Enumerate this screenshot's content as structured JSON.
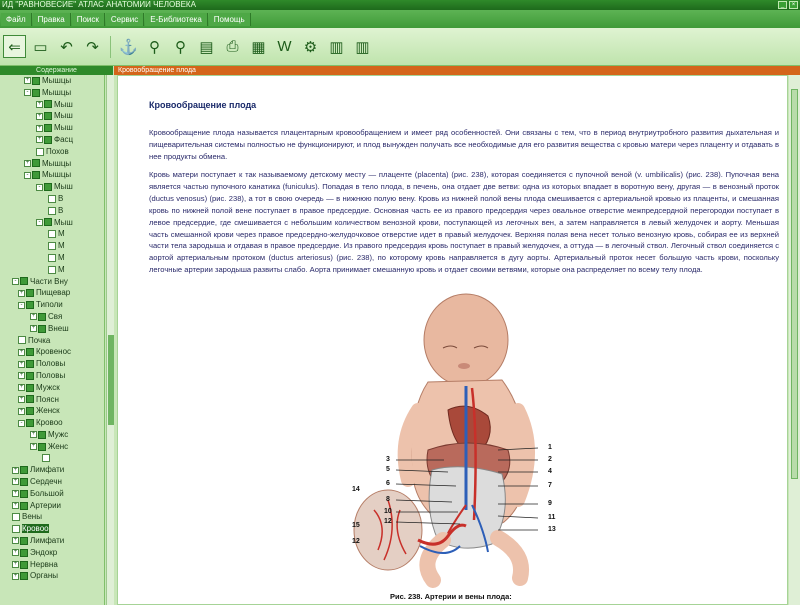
{
  "app": {
    "title": "ИД \"РАВНОВЕСИЕ\" АТЛАС АНАТОМИИ ЧЕЛОВЕКА"
  },
  "menu": [
    "Файл",
    "Правка",
    "Поиск",
    "Сервис",
    "Е-Библиотека",
    "Помощь"
  ],
  "toolbar": {
    "icons": [
      "arrow-left-icon",
      "folder-icon",
      "undo-icon",
      "redo-icon",
      "anchor-icon",
      "search-icon",
      "search-replace-icon",
      "print-preview-icon",
      "print-icon",
      "export-icon",
      "word-icon",
      "settings-icon",
      "library-icon",
      "bookshelf-icon"
    ]
  },
  "tree_panel": {
    "header": "Содержание",
    "items": [
      {
        "indent": 4,
        "expand": "+",
        "label": "Мышцы"
      },
      {
        "indent": 4,
        "expand": "-",
        "label": "Мышцы"
      },
      {
        "indent": 6,
        "expand": "+",
        "label": "Мыш"
      },
      {
        "indent": 6,
        "expand": "+",
        "label": "Мыш"
      },
      {
        "indent": 6,
        "expand": "+",
        "label": "Мыш"
      },
      {
        "indent": 6,
        "expand": "+",
        "label": "Фасц"
      },
      {
        "indent": 6,
        "expand": "",
        "label": "Похов"
      },
      {
        "indent": 4,
        "expand": "+",
        "label": "Мышцы"
      },
      {
        "indent": 4,
        "expand": "-",
        "label": "Мышцы"
      },
      {
        "indent": 6,
        "expand": "-",
        "label": "Мыш"
      },
      {
        "indent": 8,
        "expand": "",
        "label": "В"
      },
      {
        "indent": 8,
        "expand": "",
        "label": "В"
      },
      {
        "indent": 6,
        "expand": "-",
        "label": "Мыш"
      },
      {
        "indent": 8,
        "expand": "",
        "label": "М"
      },
      {
        "indent": 8,
        "expand": "",
        "label": "М"
      },
      {
        "indent": 8,
        "expand": "",
        "label": "М"
      },
      {
        "indent": 8,
        "expand": "",
        "label": "М"
      },
      {
        "indent": 2,
        "expand": "-",
        "label": "Части Вну"
      },
      {
        "indent": 3,
        "expand": "+",
        "label": "Пищевар"
      },
      {
        "indent": 3,
        "expand": "-",
        "label": "Типоли"
      },
      {
        "indent": 5,
        "expand": "+",
        "label": "Свя"
      },
      {
        "indent": 5,
        "expand": "+",
        "label": "Внеш"
      },
      {
        "indent": 3,
        "expand": "",
        "label": "Почка"
      },
      {
        "indent": 3,
        "expand": "+",
        "label": "Кровенос"
      },
      {
        "indent": 3,
        "expand": "+",
        "label": "Половы"
      },
      {
        "indent": 3,
        "expand": "+",
        "label": "Половы"
      },
      {
        "indent": 3,
        "expand": "+",
        "label": "Мужск"
      },
      {
        "indent": 3,
        "expand": "+",
        "label": "Поясн"
      },
      {
        "indent": 3,
        "expand": "+",
        "label": "Женск"
      },
      {
        "indent": 3,
        "expand": "-",
        "label": "Кровоо"
      },
      {
        "indent": 5,
        "expand": "+",
        "label": "Мужс"
      },
      {
        "indent": 5,
        "expand": "+",
        "label": "Женс"
      },
      {
        "indent": 7,
        "expand": "",
        "label": ""
      },
      {
        "indent": 2,
        "expand": "+",
        "label": "Лимфати"
      },
      {
        "indent": 2,
        "expand": "+",
        "label": "Сердечн"
      },
      {
        "indent": 2,
        "expand": "+",
        "label": "Большой"
      },
      {
        "indent": 2,
        "expand": "+",
        "label": "Артерии"
      },
      {
        "indent": 2,
        "expand": "",
        "label": "Вены"
      },
      {
        "indent": 2,
        "expand": "",
        "label": "Кровоо",
        "selected": true
      },
      {
        "indent": 2,
        "expand": "+",
        "label": "Лимфати"
      },
      {
        "indent": 2,
        "expand": "+",
        "label": "Эндокр"
      },
      {
        "indent": 2,
        "expand": "+",
        "label": "Нервна"
      },
      {
        "indent": 2,
        "expand": "+",
        "label": "Органы"
      }
    ]
  },
  "content": {
    "header": "Кровообращение плода",
    "title": "Кровообращение плода",
    "paragraph1": "Кровообращение плода называется плацентарным кровообращением и имеет ряд особенностей. Они связаны с тем, что в период внутриутробного развития дыхательная и пищеварительная системы полностью не функционируют, и плод вынужден получать все необходимые для его развития вещества с кровью матери через плаценту и отдавать в нее продукты обмена.",
    "paragraph2": "Кровь матери поступает к так называемому детскому месту — плаценте (placenta) (рис. 238), которая соединяется с пупочной веной (v. umbilicalis) (рис. 238). Пупочная вена является частью пупочного канатика (funiculus). Попадая в тело плода, в печень, она отдает две ветви: одна из которых впадает в воротную вену, другая — в венозный проток (ductus venosus) (рис. 238), а тот в свою очередь — в нижнюю полую вену. Кровь из нижней полой вены плода смешивается с артериальной кровью из плаценты, и смешанная кровь по нижней полой вене поступает в правое предсердие. Основная часть ее из правого предсердия через овальное отверстие межпредсердной перегородки поступает в левое предсердие, где смешивается с небольшим количеством венозной крови, поступающей из легочных вен, а затем направляется в левый желудочек и аорту. Меньшая часть смешанной крови через правое предсердно-желудочковое отверстие идет в правый желудочек. Верхняя полая вена несет только венозную кровь, собирая ее из верхней части тела зародыша и отдавая в правое предсердие. Из правого предсердия кровь поступает в правый желудочек, а оттуда — в легочный ствол. Легочный ствол соединяется с аортой артериальным протоком (ductus arteriosus) (рис. 238), по которому кровь направляется в дугу аорты. Артериальный проток несет большую часть крови, поскольку легочные артерии зародыша развиты слабо. Аорта принимает смешанную кровь и отдает своими ветвями, которые она распределяет по всему телу плода.",
    "figure": {
      "callouts_right": [
        "1",
        "2",
        "4",
        "7",
        "9",
        "11",
        "13"
      ],
      "callouts_left": [
        "3",
        "5",
        "6",
        "8",
        "10",
        "12"
      ],
      "callouts_lower_left": [
        "14",
        "15",
        "12"
      ],
      "caption": "Рис. 238. Артерии и вены плода:"
    }
  },
  "colors": {
    "accent_green": "#2f8a2a",
    "panel_green": "#c8e6b8",
    "header_orange": "#d4651a",
    "text_blue": "#2a2a6a"
  }
}
